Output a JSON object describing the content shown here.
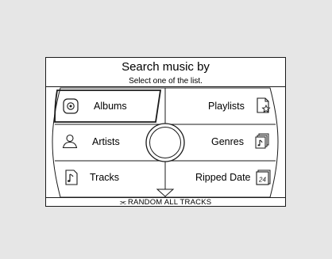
{
  "screen": {
    "title": "Search music by",
    "subtitle": "Select one of the list."
  },
  "menu": {
    "albums": {
      "label": "Albums",
      "icon": "disc-icon"
    },
    "artists": {
      "label": "Artists",
      "icon": "person-icon"
    },
    "tracks": {
      "label": "Tracks",
      "icon": "music-note-icon"
    },
    "playlists": {
      "label": "Playlists",
      "icon": "playlist-star-icon"
    },
    "genres": {
      "label": "Genres",
      "icon": "genre-stack-icon"
    },
    "ripped_date": {
      "label": "Ripped Date",
      "icon": "calendar-icon",
      "day": "24"
    }
  },
  "random": {
    "label": "RANDOM ALL TRACKS",
    "icon": "shuffle-icon"
  }
}
